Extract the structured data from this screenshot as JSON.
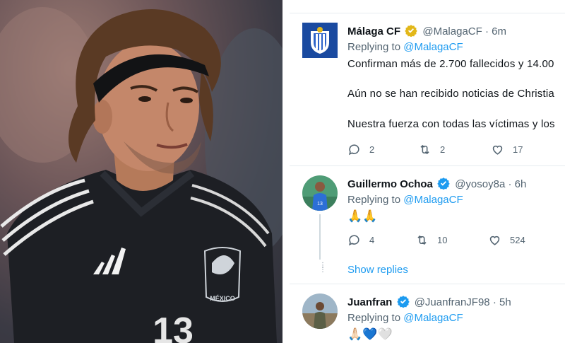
{
  "photo": {
    "jersey_badge_text": "MÉXICO",
    "jersey_number": "13"
  },
  "tweets": [
    {
      "display_name": "Málaga CF",
      "handle": "@MalagaCF",
      "time": "· 6m",
      "replying_prefix": "Replying to",
      "replying_to": "@MalagaCF",
      "lines": [
        "Confirman más de 2.700 fallecidos y 14.00",
        "Aún no se han recibido noticias de Christia",
        "Nuestra fuerza con todas las víctimas y los"
      ],
      "replies": "2",
      "retweets": "2",
      "likes": "17",
      "avatar_icon": "malaga-crest-icon"
    },
    {
      "display_name": "Guillermo Ochoa",
      "handle": "@yosoy8a",
      "time": "· 6h",
      "replying_prefix": "Replying to",
      "replying_to": "@MalagaCF",
      "lines": [
        "🙏🙏"
      ],
      "replies": "4",
      "retweets": "10",
      "likes": "524",
      "show_replies": "Show replies"
    },
    {
      "display_name": "Juanfran",
      "handle": "@JuanfranJF98",
      "time": "· 5h",
      "replying_prefix": "Replying to",
      "replying_to": "@MalagaCF",
      "lines": [
        "🙏🏻💙🤍"
      ]
    }
  ],
  "colors": {
    "accent": "#1d9bf0",
    "verified_gold": "#e2b719",
    "verified_blue": "#1d9bf0",
    "text": "#0f1419",
    "muted": "#536471",
    "malaga_blue": "#1a4aa0"
  }
}
